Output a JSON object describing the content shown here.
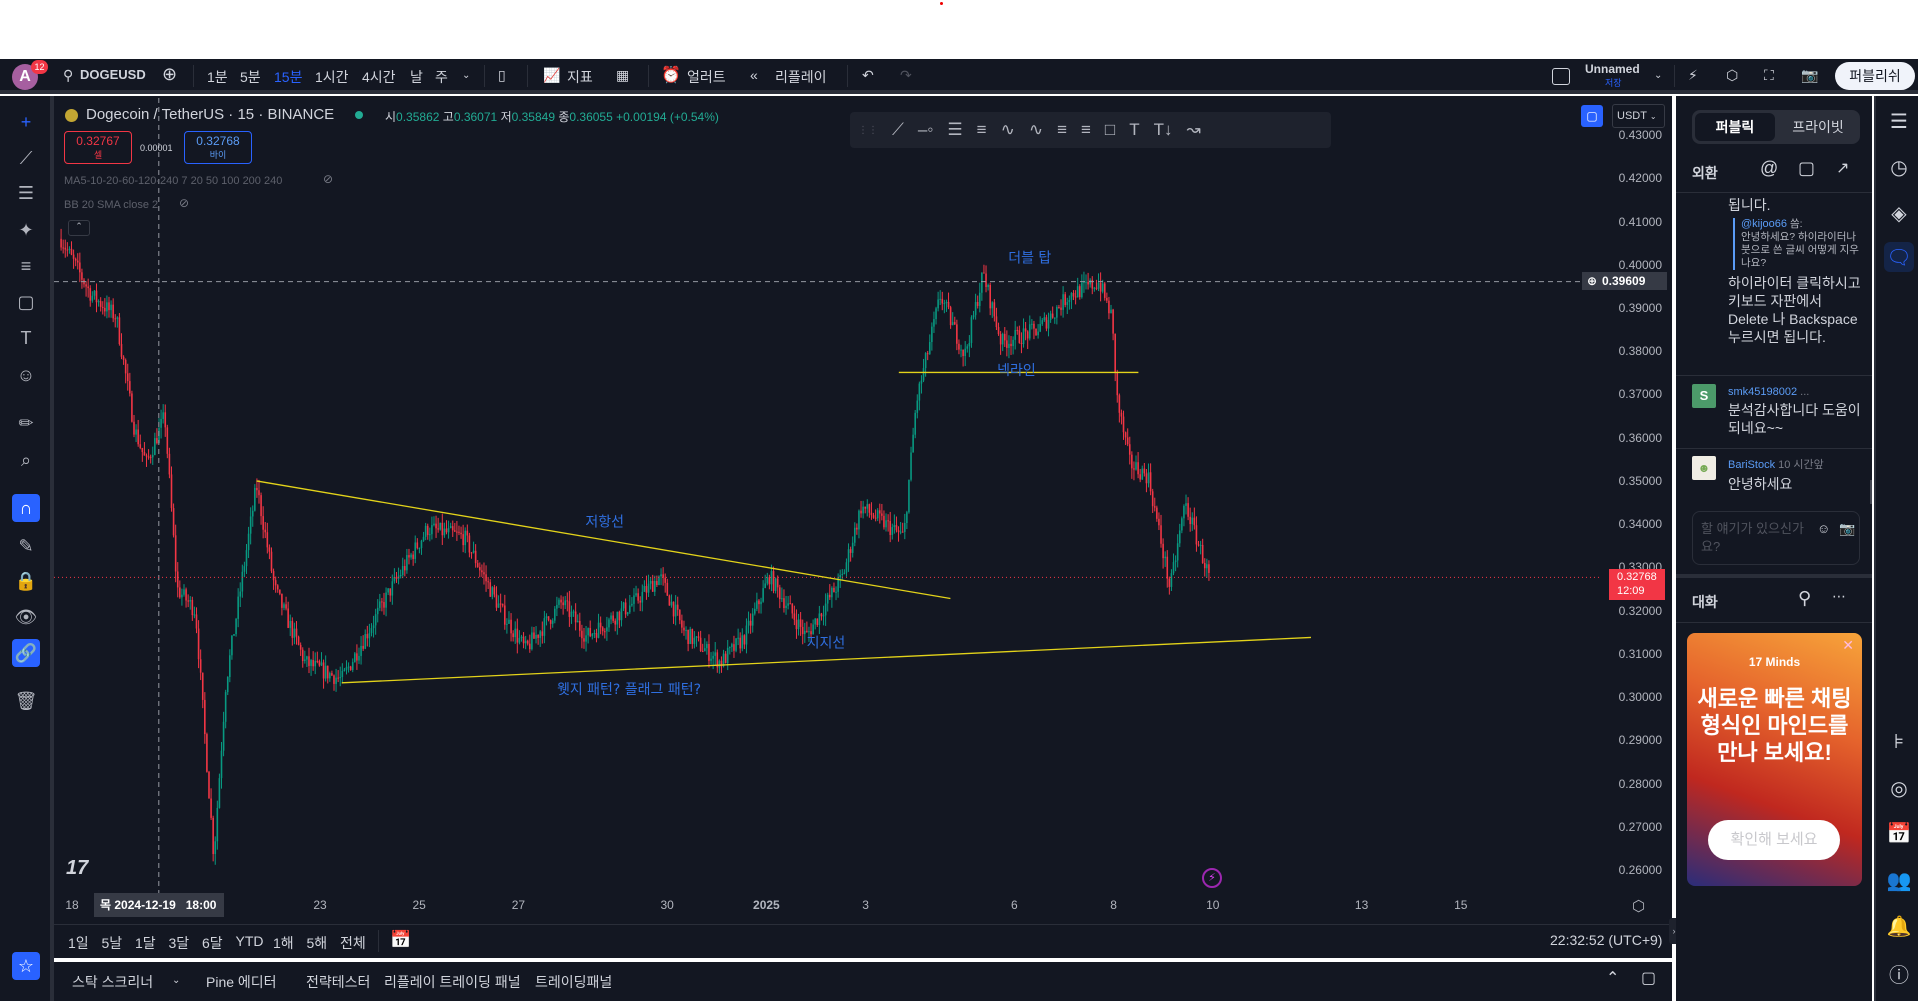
{
  "toolbar": {
    "avatar_letter": "A",
    "notif_count": "12",
    "symbol": "DOGEUSD",
    "intervals": [
      "1분",
      "5분",
      "15분",
      "1시간",
      "4시간",
      "날",
      "주"
    ],
    "active_interval": "15분",
    "indicators": "지표",
    "alert": "얼러트",
    "replay": "리플레이",
    "layout_name": "Unnamed",
    "layout_status": "저장",
    "publish": "퍼블리쉬"
  },
  "legend": {
    "title": "Dogecoin / TetherUS · 15 · BINANCE",
    "o_label": "시",
    "o": "0.35862",
    "h_label": "고",
    "h": "0.36071",
    "l_label": "저",
    "l": "0.35849",
    "c_label": "종",
    "c": "0.36055",
    "change": "+0.00194 (+0.54%)",
    "sell_price": "0.32767",
    "sell_label": "셀",
    "spread": "0.00001",
    "buy_price": "0.32768",
    "buy_label": "바이",
    "indicator1": "MA5-10-20-60-120-240 7 20 50 100 200 240",
    "indicator2": "BB 20 SMA close 2"
  },
  "currency": "USDT",
  "price_axis": {
    "ticks": [
      "0.43000",
      "0.42000",
      "0.41000",
      "0.40000",
      "0.39000",
      "0.38000",
      "0.37000",
      "0.36000",
      "0.35000",
      "0.34000",
      "0.33000",
      "0.32000",
      "0.31000",
      "0.30000",
      "0.29000",
      "0.28000",
      "0.27000",
      "0.26000"
    ],
    "crosshair_price": "0.39609",
    "last_price": "0.32768",
    "countdown": "12:09"
  },
  "time_axis": {
    "ticks": [
      {
        "label": "18",
        "day": 0
      },
      {
        "label": "23",
        "day": 5
      },
      {
        "label": "25",
        "day": 7
      },
      {
        "label": "27",
        "day": 9
      },
      {
        "label": "30",
        "day": 12
      },
      {
        "label": "2025",
        "day": 14
      },
      {
        "label": "3",
        "day": 16
      },
      {
        "label": "6",
        "day": 19
      },
      {
        "label": "8",
        "day": 21
      },
      {
        "label": "10",
        "day": 23
      },
      {
        "label": "13",
        "day": 26
      },
      {
        "label": "15",
        "day": 28
      }
    ],
    "crosshair_label": "목 2024-12-19   18:00",
    "crosshair_day": 1.75
  },
  "chart_data": {
    "type": "candlestick",
    "x_unit": "days since 2024-12-18",
    "ylim": [
      0.255,
      0.435
    ],
    "price_path": [
      [
        -0.22,
        0.406
      ],
      [
        0.39,
        0.393
      ],
      [
        0.89,
        0.388
      ],
      [
        1.26,
        0.362
      ],
      [
        1.5,
        0.354
      ],
      [
        1.87,
        0.365
      ],
      [
        2.12,
        0.325
      ],
      [
        2.49,
        0.32
      ],
      [
        2.86,
        0.263
      ],
      [
        3.1,
        0.303
      ],
      [
        3.72,
        0.349
      ],
      [
        4.09,
        0.325
      ],
      [
        4.7,
        0.308
      ],
      [
        5.44,
        0.304
      ],
      [
        6.43,
        0.325
      ],
      [
        7.17,
        0.339
      ],
      [
        7.91,
        0.337
      ],
      [
        8.65,
        0.32
      ],
      [
        9.14,
        0.311
      ],
      [
        9.88,
        0.322
      ],
      [
        10.37,
        0.314
      ],
      [
        11.35,
        0.322
      ],
      [
        11.85,
        0.328
      ],
      [
        12.34,
        0.315
      ],
      [
        13.08,
        0.308
      ],
      [
        13.57,
        0.314
      ],
      [
        14.06,
        0.328
      ],
      [
        14.8,
        0.314
      ],
      [
        15.54,
        0.328
      ],
      [
        15.91,
        0.344
      ],
      [
        16.77,
        0.337
      ],
      [
        17.02,
        0.368
      ],
      [
        17.51,
        0.393
      ],
      [
        18.0,
        0.379
      ],
      [
        18.37,
        0.398
      ],
      [
        18.74,
        0.382
      ],
      [
        19.48,
        0.385
      ],
      [
        20.1,
        0.393
      ],
      [
        20.71,
        0.396
      ],
      [
        20.96,
        0.388
      ],
      [
        21.08,
        0.368
      ],
      [
        21.33,
        0.354
      ],
      [
        21.7,
        0.351
      ],
      [
        22.14,
        0.325
      ],
      [
        22.44,
        0.345
      ],
      [
        22.93,
        0.3277
      ]
    ],
    "drawings": [
      {
        "name": "resistance-line",
        "from": [
          3.72,
          0.35
        ],
        "to": [
          17.71,
          0.3228
        ]
      },
      {
        "name": "support-line",
        "from": [
          5.44,
          0.3033
        ],
        "to": [
          24.98,
          0.3138
        ]
      },
      {
        "name": "neckline",
        "from": [
          16.67,
          0.3751
        ],
        "to": [
          21.5,
          0.3751
        ]
      }
    ],
    "annotations": [
      {
        "text": "저항선",
        "day": 10.74,
        "price": 0.3395
      },
      {
        "text": "지지선",
        "day": 15.2,
        "price": 0.3115
      },
      {
        "text": "웻지 패턴? 플래그 패턴?",
        "day": 11.23,
        "price": 0.3007
      },
      {
        "text": "더블 탑",
        "day": 19.31,
        "price": 0.4005
      },
      {
        "text": "넥라인",
        "day": 19.04,
        "price": 0.3745
      }
    ]
  },
  "range_bar": {
    "ranges": [
      "1일",
      "5날",
      "1달",
      "3달",
      "6달",
      "YTD",
      "1해",
      "5해",
      "전체"
    ],
    "clock": "22:32:52 (UTC+9)"
  },
  "bottom_tabs": [
    "스탁 스크리너",
    "Pine 에디터",
    "전략테스터",
    "리플레이 트레이딩 패널",
    "트레이딩패널"
  ],
  "chat": {
    "tab_public": "퍼블릭",
    "tab_private": "프라이빗",
    "room": "외환",
    "msg0_tail": "됩니다.",
    "quote_user": "@kijoo66",
    "quote_suffix": " 씀:",
    "quote_text": "안녕하세요? 하이라이터나 붓으로 쓴 글씨 어떻게 지우나요?",
    "reply": "하이라이터 클릭하시고 키보드 자판에서 Delete 나 Backspace 누르시면 됩니다.",
    "msg1_avatar": "S",
    "msg1_user": "smk45198002",
    "msg1_time": "...",
    "msg1_text": "분석감사합니다 도움이되네요~~",
    "msg2_user": "BariStock",
    "msg2_time": "10 시간앞",
    "msg2_text": "안녕하세요",
    "input_placeholder": "할 얘기가 있으신가요?",
    "conversations": "대화",
    "ad_brand": "Minds",
    "ad_text": "새로운 빠른 채팅 형식인 마인드를 만나 보세요!",
    "ad_button": "확인해 보세요"
  },
  "colors": {
    "up": "#089981",
    "down": "#f23645",
    "accent": "#2962ff",
    "drawing": "#e3d31a",
    "annotation": "#2f6fe0"
  }
}
